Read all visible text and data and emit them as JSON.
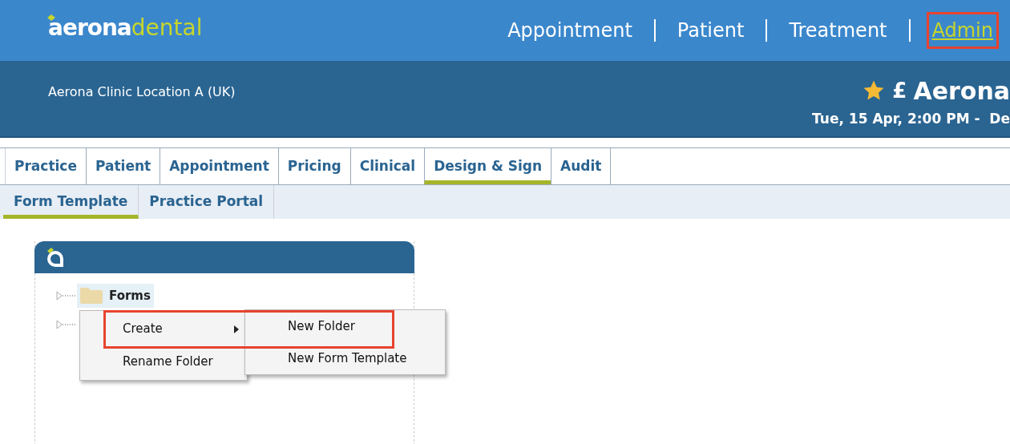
{
  "logo": {
    "part_1": "aerona",
    "part_2": "dental"
  },
  "top_nav": [
    {
      "label": "Appointment",
      "selected": false,
      "highlighted": false
    },
    {
      "label": "Patient",
      "selected": false,
      "highlighted": false
    },
    {
      "label": "Treatment",
      "selected": false,
      "highlighted": false
    },
    {
      "label": "Admin",
      "selected": true,
      "highlighted": true
    }
  ],
  "location": "Aerona Clinic Location A (UK)",
  "user": {
    "symbol": "£",
    "name": "Aerona",
    "datetime": "Tue, 15 Apr, 2:00 PM -  De"
  },
  "tabs": [
    {
      "label": "Practice",
      "selected": false
    },
    {
      "label": "Patient",
      "selected": false
    },
    {
      "label": "Appointment",
      "selected": false
    },
    {
      "label": "Pricing",
      "selected": false
    },
    {
      "label": "Clinical",
      "selected": false
    },
    {
      "label": "Design & Sign",
      "selected": true
    },
    {
      "label": "Audit",
      "selected": false
    }
  ],
  "subtabs": [
    {
      "label": "Form Template",
      "selected": true
    },
    {
      "label": "Practice Portal",
      "selected": false
    }
  ],
  "tree": [
    {
      "kind": "folder",
      "label": "Forms"
    },
    {
      "kind": "branch"
    }
  ],
  "context_menu": {
    "highlighted": true,
    "items": [
      {
        "label": "Create",
        "has_submenu": true
      },
      {
        "label": "Rename Folder",
        "has_submenu": false
      }
    ],
    "submenu": [
      {
        "label": "New Folder"
      },
      {
        "label": "New Form Template"
      }
    ]
  }
}
